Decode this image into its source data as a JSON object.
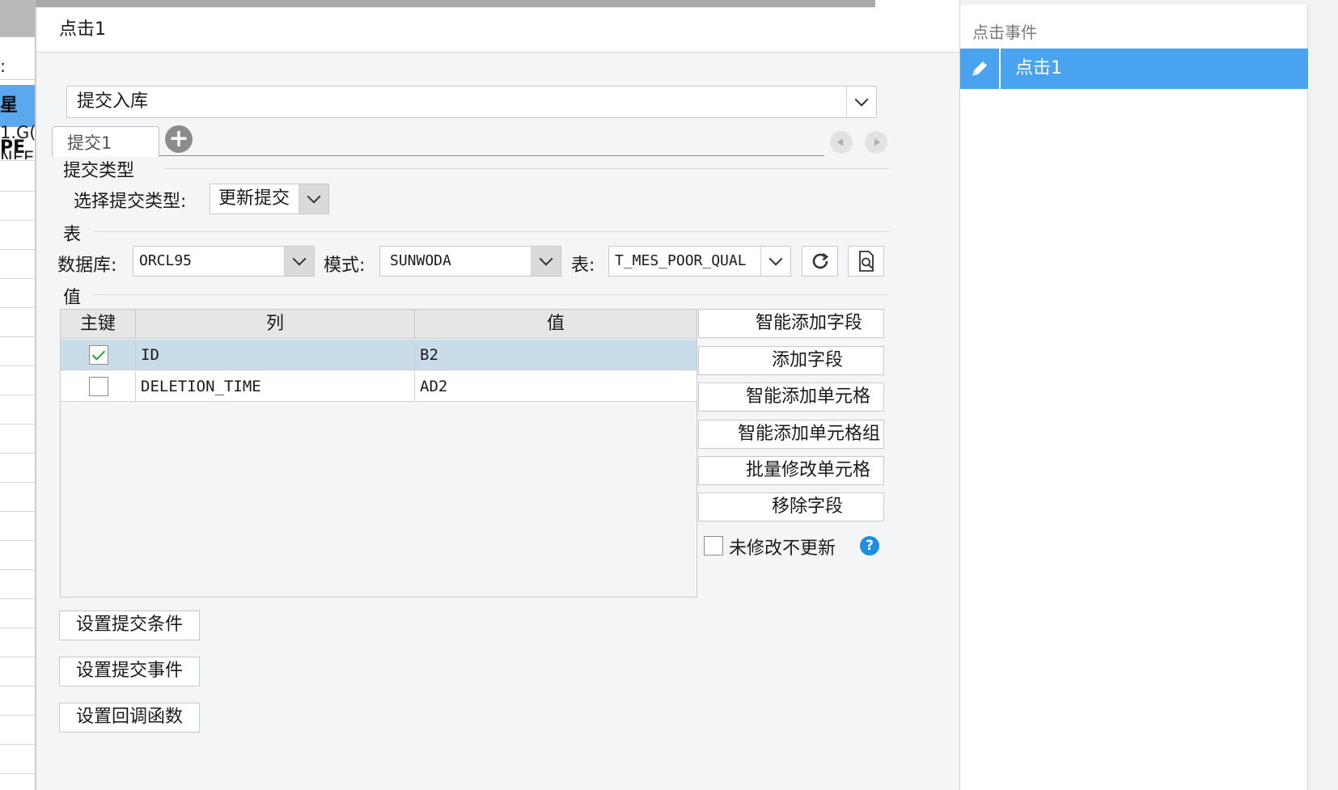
{
  "left_sheet": {
    "cell_selected_text": "星PE",
    "cell_row2": "1.G(",
    "cell_row3": "NEE",
    "header_fragment": ":"
  },
  "dialog": {
    "title": "点击1",
    "action_select": "提交入库",
    "tabs": [
      {
        "label": "提交1"
      }
    ],
    "submit_type": {
      "section_label": "提交类型",
      "field_label": "选择提交类型:",
      "value": "更新提交"
    },
    "table_section": {
      "section_label": "表",
      "db_label": "数据库:",
      "db_value": "ORCL95",
      "schema_label": "模式:",
      "schema_value": "SUNWODA",
      "table_label": "表:",
      "table_value": "T_MES_POOR_QUAL"
    },
    "value_section": {
      "section_label": "值",
      "headers": {
        "pk": "主键",
        "column": "列",
        "value": "值"
      },
      "rows": [
        {
          "pk": true,
          "column": "ID",
          "value": "B2"
        },
        {
          "pk": false,
          "column": "DELETION_TIME",
          "value": "AD2"
        }
      ]
    },
    "side_buttons": {
      "smart_add_field": "智能添加字段",
      "add_field": "添加字段",
      "smart_add_cell": "智能添加单元格",
      "smart_add_cell_group": "智能添加单元格组",
      "batch_edit_cell": "批量修改单元格",
      "remove_field": "移除字段"
    },
    "no_update_unmodified": {
      "label": "未修改不更新",
      "checked": false
    },
    "bottom_buttons": {
      "set_condition": "设置提交条件",
      "set_event": "设置提交事件",
      "set_callback": "设置回调函数"
    }
  },
  "event_panel": {
    "header": "点击事件",
    "items": [
      {
        "label": "点击1",
        "selected": true
      }
    ]
  },
  "colors": {
    "selection_blue": "#4aa3ee",
    "selected_row": "#c8dcea",
    "help_blue": "#1e8fe0"
  }
}
